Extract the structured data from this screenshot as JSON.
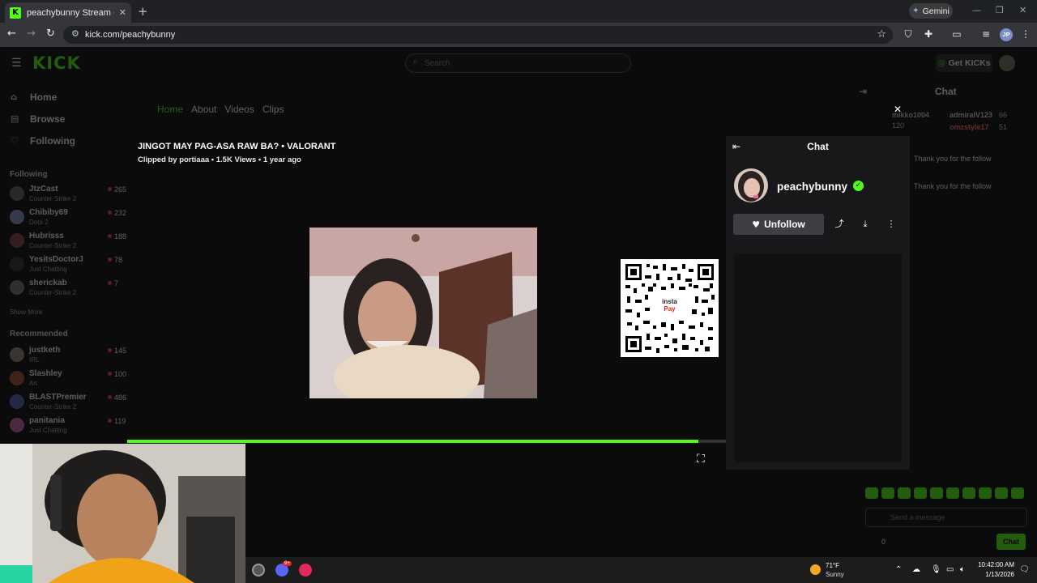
{
  "browser": {
    "tab_title": "peachybunny Stream - Watch Live",
    "tab_favicon": "K",
    "new_tab_icon": "+",
    "gemini_label": "Gemini",
    "url": "kick.com/peachybunny",
    "profile_initials": "JP"
  },
  "kick": {
    "logo": "KICK",
    "search_placeholder": "Search",
    "get_kicks_label": "Get KICKs",
    "nav": [
      {
        "label": "Home",
        "icon": "home-icon"
      },
      {
        "label": "Browse",
        "icon": "browse-icon"
      },
      {
        "label": "Following",
        "icon": "heart-icon"
      }
    ],
    "following_title": "Following",
    "following": [
      {
        "name": "JtzCast",
        "game": "Counter-Strike 2",
        "viewers": "265"
      },
      {
        "name": "Chibiby69",
        "game": "Dota 2",
        "viewers": "232"
      },
      {
        "name": "Hubrisss",
        "game": "Counter-Strike 2",
        "viewers": "188"
      },
      {
        "name": "YesitsDoctorJ",
        "game": "Just Chatting",
        "viewers": "78"
      },
      {
        "name": "sherickab",
        "game": "Counter-Strike 2",
        "viewers": "7"
      }
    ],
    "show_more": "Show More",
    "recommended_title": "Recommended",
    "recommended": [
      {
        "name": "justketh",
        "game": "IRL",
        "viewers": "145"
      },
      {
        "name": "Slashley",
        "game": "Art",
        "viewers": "100"
      },
      {
        "name": "BLASTPremier",
        "game": "Counter-Strike 2",
        "viewers": "486"
      },
      {
        "name": "panitania",
        "game": "Just Chatting",
        "viewers": "119"
      }
    ],
    "page_tabs": [
      "Home",
      "About",
      "Videos",
      "Clips"
    ],
    "right_chat": {
      "title": "Chat",
      "top_users": [
        "mikko1004",
        "admiralV123",
        "omzstyle17"
      ],
      "top_user_counts": [
        "120",
        "66",
        "51"
      ],
      "messages": [
        "Thank you for the follow",
        "Thank you for the follow"
      ],
      "input_placeholder": "Send a message",
      "count": "0",
      "send_label": "Chat"
    }
  },
  "clip": {
    "title": "JINGOT MAY PAG-ASA RAW BA? • VALORANT",
    "meta": "Clipped by portiaaa • 1.5K Views • 1 year ago",
    "progress_fraction": 0.954,
    "qr_text_line1": "insta",
    "qr_text_line2": "Pay"
  },
  "panel": {
    "title": "Chat",
    "streamer": "peachybunny",
    "unfollow_label": "Unfollow"
  },
  "taskbar": {
    "discord_badge": "9+",
    "weather_temp": "71°F",
    "weather_desc": "Sunny",
    "time": "10:42:00 AM",
    "date": "1/13/2026"
  },
  "colors": {
    "accent": "#53fc18",
    "panel_bg": "#18181b",
    "button_bg": "#3d3f45"
  }
}
